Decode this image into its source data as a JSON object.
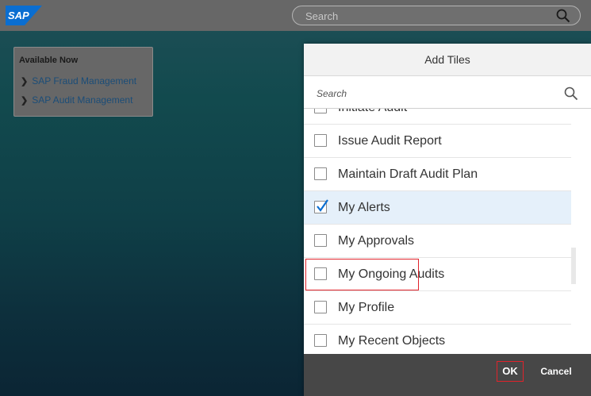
{
  "shell": {
    "logo_text": "SAP",
    "search_placeholder": "Search",
    "colors": {
      "bar": "#676767",
      "logo_blue": "#0a6ed1"
    }
  },
  "catalog": {
    "title": "Available Now",
    "links": [
      {
        "label": "SAP Fraud Management",
        "icon": "chevron-right-icon"
      },
      {
        "label": "SAP Audit Management",
        "icon": "chevron-right-icon"
      }
    ]
  },
  "dialog": {
    "title": "Add Tiles",
    "search_placeholder": "Search",
    "items": [
      {
        "label": "Initiate Audit",
        "checked": false
      },
      {
        "label": "Issue Audit Report",
        "checked": false
      },
      {
        "label": "Maintain Draft Audit Plan",
        "checked": false
      },
      {
        "label": "My Alerts",
        "checked": true
      },
      {
        "label": "My Approvals",
        "checked": false
      },
      {
        "label": "My Ongoing Audits",
        "checked": false
      },
      {
        "label": "My Profile",
        "checked": false
      },
      {
        "label": "My Recent Objects",
        "checked": false
      }
    ],
    "footer": {
      "ok_label": "OK",
      "cancel_label": "Cancel"
    },
    "colors": {
      "highlight": "#e0232b",
      "selected_row": "#e5f0fa",
      "check": "#0a6ed1"
    }
  }
}
